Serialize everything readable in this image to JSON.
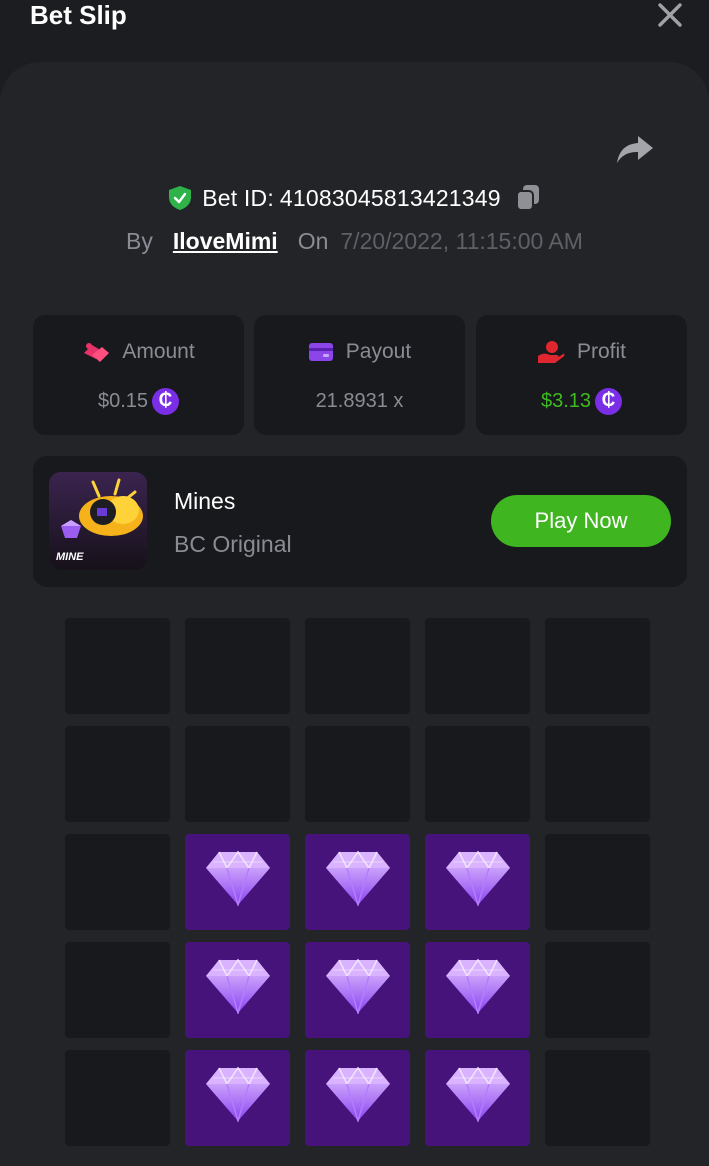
{
  "header": {
    "title": "Bet Slip",
    "close_icon": "close-icon"
  },
  "bet": {
    "id_label": "Bet ID:",
    "id_value": "41083045813421349",
    "by_label": "By",
    "user": "IloveMimi",
    "on_label": "On",
    "date": "7/20/2022, 11:15:00 AM"
  },
  "stats": {
    "amount": {
      "label": "Amount",
      "value": "$0.15",
      "icon": "amount-icon"
    },
    "payout": {
      "label": "Payout",
      "value": "21.8931 x",
      "icon": "card-icon"
    },
    "profit": {
      "label": "Profit",
      "value": "$3.13",
      "icon": "hand-coin-icon"
    },
    "coin_symbol": "₵"
  },
  "game": {
    "name": "Mines",
    "provider": "BC Original",
    "thumb_label": "MINE",
    "play_label": "Play Now"
  },
  "board": {
    "rows": 5,
    "cols": 5,
    "cells": [
      [
        "empty",
        "empty",
        "empty",
        "empty",
        "empty"
      ],
      [
        "empty",
        "empty",
        "empty",
        "empty",
        "empty"
      ],
      [
        "empty",
        "gem",
        "gem",
        "gem",
        "empty"
      ],
      [
        "empty",
        "gem",
        "gem",
        "gem",
        "empty"
      ],
      [
        "empty",
        "gem",
        "gem",
        "gem",
        "empty"
      ]
    ]
  },
  "colors": {
    "accent_green": "#3fb520",
    "profit_green": "#3dbb1f",
    "gem_tile": "#45137a",
    "coin_purple": "#7a2ee6"
  }
}
